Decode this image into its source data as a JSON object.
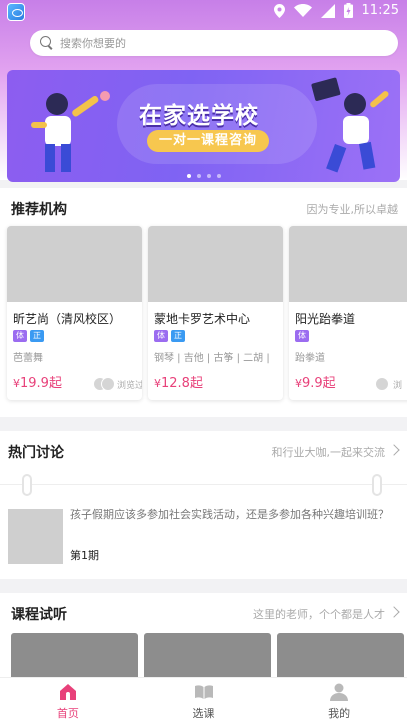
{
  "status_bar": {
    "time": "11:25"
  },
  "search": {
    "placeholder": "搜索你想要的"
  },
  "banner": {
    "title": "在家选学校",
    "subtitle": "一对一课程咨询",
    "slide_count": 4,
    "active_slide": 1
  },
  "recommended": {
    "title": "推荐机构",
    "more": "因为专业,所以卓越",
    "orgs": [
      {
        "name": "昕艺尚（清风校区）",
        "tags": [
          "体",
          "正"
        ],
        "category": "芭蕾舞",
        "price_cur": "¥",
        "price": "19.9起",
        "viewed": "浏览过"
      },
      {
        "name": "蒙地卡罗艺术中心",
        "tags": [
          "体",
          "正"
        ],
        "category": "钢琴 | 吉他 | 古筝 | 二胡 |",
        "price_cur": "¥",
        "price": "12.8起",
        "viewed": ""
      },
      {
        "name": "阳光跆拳道",
        "tags": [
          "体"
        ],
        "category": "跆拳道",
        "price_cur": "¥",
        "price": "9.9起",
        "viewed": "浏"
      }
    ]
  },
  "discussion": {
    "title": "热门讨论",
    "more": "和行业大咖,一起来交流",
    "post": {
      "text": "孩子假期应该多参加社会实践活动，还是多参加各种兴趣培训班？",
      "issue": "第1期"
    }
  },
  "trial": {
    "title": "课程试听",
    "more": "这里的老师，个个都是人才"
  },
  "tabbar": {
    "items": [
      {
        "label": "首页",
        "icon": "home-icon",
        "active": true
      },
      {
        "label": "选课",
        "icon": "book-icon",
        "active": false
      },
      {
        "label": "我的",
        "icon": "user-icon",
        "active": false
      }
    ]
  },
  "colors": {
    "accent": "#e8417a",
    "tag_ti": "#9b6cf0",
    "tag_zheng": "#3a9af2",
    "banner": "#8d5df0"
  }
}
